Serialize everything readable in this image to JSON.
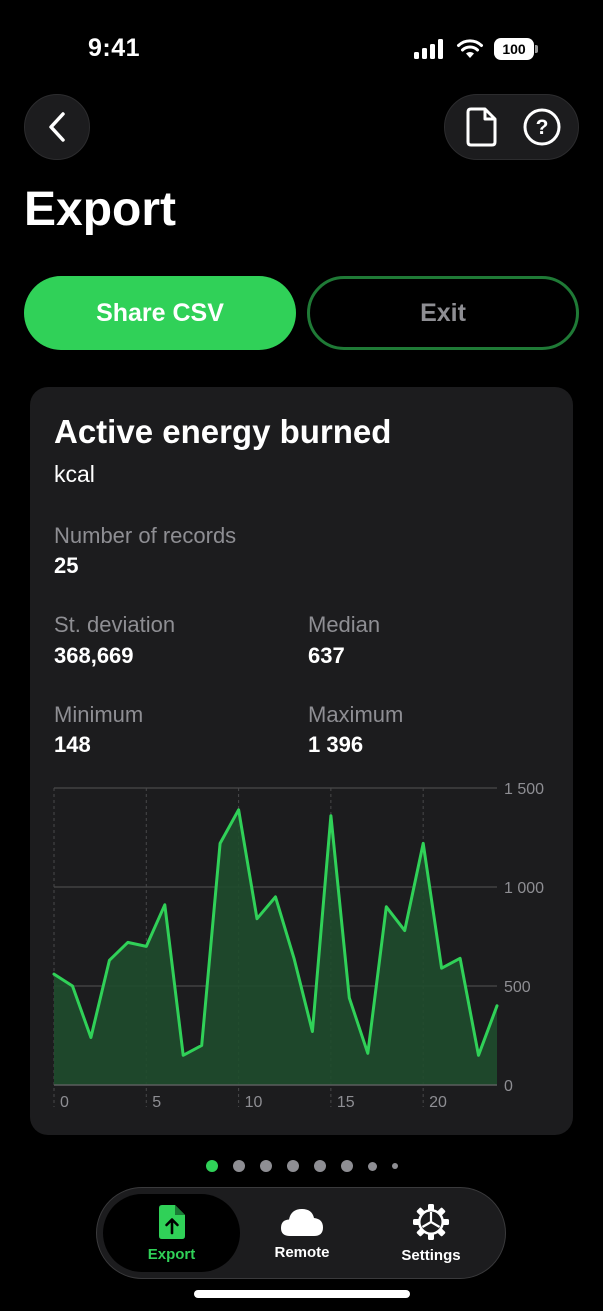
{
  "status_bar": {
    "time": "9:41",
    "battery": "100"
  },
  "header": {
    "title": "Export"
  },
  "actions": {
    "share_label": "Share CSV",
    "exit_label": "Exit"
  },
  "card": {
    "title": "Active energy burned",
    "unit": "kcal",
    "stats": {
      "records_label": "Number of records",
      "records_value": "25",
      "stdev_label": "St. deviation",
      "stdev_value": "368,669",
      "median_label": "Median",
      "median_value": "637",
      "min_label": "Minimum",
      "min_value": "148",
      "max_label": "Maximum",
      "max_value": "1 396"
    }
  },
  "chart_data": {
    "type": "area",
    "x": [
      0,
      1,
      2,
      3,
      4,
      5,
      6,
      7,
      8,
      9,
      10,
      11,
      12,
      13,
      14,
      15,
      16,
      17,
      18,
      19,
      20,
      21,
      22,
      23,
      24
    ],
    "values": [
      560,
      500,
      240,
      630,
      720,
      700,
      910,
      150,
      200,
      1220,
      1390,
      840,
      950,
      640,
      270,
      1360,
      440,
      160,
      900,
      780,
      1220,
      590,
      640,
      150,
      400
    ],
    "x_ticks": [
      0,
      5,
      10,
      15,
      20
    ],
    "x_tick_labels": [
      "0",
      "5",
      "10",
      "15",
      "20"
    ],
    "y_ticks": [
      0,
      500,
      1000,
      1500
    ],
    "y_tick_labels": [
      "0",
      "500",
      "1 000",
      "1 500"
    ],
    "xlim": [
      0,
      24
    ],
    "ylim": [
      0,
      1500
    ],
    "line_color": "#30d158",
    "fill_color": "#1f4d2c"
  },
  "pagination": {
    "count": 8,
    "active": 0
  },
  "tabbar": {
    "items": [
      {
        "label": "Export",
        "icon": "export-doc-icon"
      },
      {
        "label": "Remote",
        "icon": "cloud-icon"
      },
      {
        "label": "Settings",
        "icon": "gear-icon"
      }
    ]
  },
  "colors": {
    "accent": "#30d158",
    "card": "#1c1c1e",
    "background": "#000000"
  }
}
